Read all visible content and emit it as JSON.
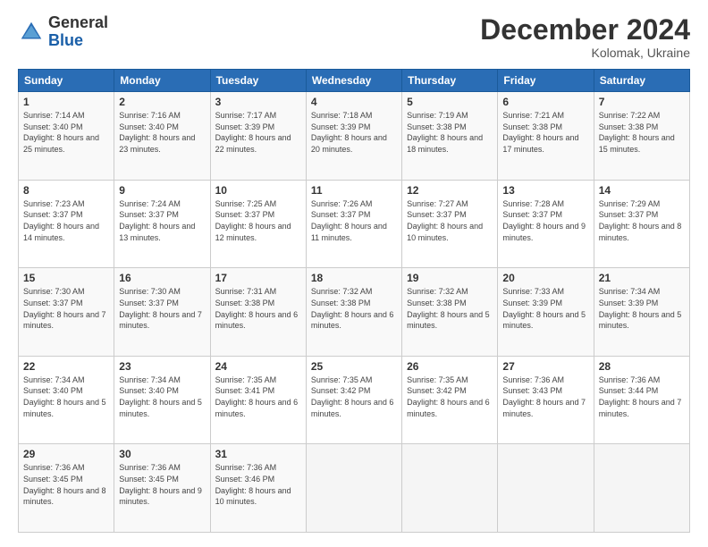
{
  "logo": {
    "general": "General",
    "blue": "Blue"
  },
  "header": {
    "month": "December 2024",
    "location": "Kolomak, Ukraine"
  },
  "weekdays": [
    "Sunday",
    "Monday",
    "Tuesday",
    "Wednesday",
    "Thursday",
    "Friday",
    "Saturday"
  ],
  "weeks": [
    [
      {
        "day": "1",
        "sunrise": "7:14 AM",
        "sunset": "3:40 PM",
        "daylight": "8 hours and 25 minutes."
      },
      {
        "day": "2",
        "sunrise": "7:16 AM",
        "sunset": "3:40 PM",
        "daylight": "8 hours and 23 minutes."
      },
      {
        "day": "3",
        "sunrise": "7:17 AM",
        "sunset": "3:39 PM",
        "daylight": "8 hours and 22 minutes."
      },
      {
        "day": "4",
        "sunrise": "7:18 AM",
        "sunset": "3:39 PM",
        "daylight": "8 hours and 20 minutes."
      },
      {
        "day": "5",
        "sunrise": "7:19 AM",
        "sunset": "3:38 PM",
        "daylight": "8 hours and 18 minutes."
      },
      {
        "day": "6",
        "sunrise": "7:21 AM",
        "sunset": "3:38 PM",
        "daylight": "8 hours and 17 minutes."
      },
      {
        "day": "7",
        "sunrise": "7:22 AM",
        "sunset": "3:38 PM",
        "daylight": "8 hours and 15 minutes."
      }
    ],
    [
      {
        "day": "8",
        "sunrise": "7:23 AM",
        "sunset": "3:37 PM",
        "daylight": "8 hours and 14 minutes."
      },
      {
        "day": "9",
        "sunrise": "7:24 AM",
        "sunset": "3:37 PM",
        "daylight": "8 hours and 13 minutes."
      },
      {
        "day": "10",
        "sunrise": "7:25 AM",
        "sunset": "3:37 PM",
        "daylight": "8 hours and 12 minutes."
      },
      {
        "day": "11",
        "sunrise": "7:26 AM",
        "sunset": "3:37 PM",
        "daylight": "8 hours and 11 minutes."
      },
      {
        "day": "12",
        "sunrise": "7:27 AM",
        "sunset": "3:37 PM",
        "daylight": "8 hours and 10 minutes."
      },
      {
        "day": "13",
        "sunrise": "7:28 AM",
        "sunset": "3:37 PM",
        "daylight": "8 hours and 9 minutes."
      },
      {
        "day": "14",
        "sunrise": "7:29 AM",
        "sunset": "3:37 PM",
        "daylight": "8 hours and 8 minutes."
      }
    ],
    [
      {
        "day": "15",
        "sunrise": "7:30 AM",
        "sunset": "3:37 PM",
        "daylight": "8 hours and 7 minutes."
      },
      {
        "day": "16",
        "sunrise": "7:30 AM",
        "sunset": "3:37 PM",
        "daylight": "8 hours and 7 minutes."
      },
      {
        "day": "17",
        "sunrise": "7:31 AM",
        "sunset": "3:38 PM",
        "daylight": "8 hours and 6 minutes."
      },
      {
        "day": "18",
        "sunrise": "7:32 AM",
        "sunset": "3:38 PM",
        "daylight": "8 hours and 6 minutes."
      },
      {
        "day": "19",
        "sunrise": "7:32 AM",
        "sunset": "3:38 PM",
        "daylight": "8 hours and 5 minutes."
      },
      {
        "day": "20",
        "sunrise": "7:33 AM",
        "sunset": "3:39 PM",
        "daylight": "8 hours and 5 minutes."
      },
      {
        "day": "21",
        "sunrise": "7:34 AM",
        "sunset": "3:39 PM",
        "daylight": "8 hours and 5 minutes."
      }
    ],
    [
      {
        "day": "22",
        "sunrise": "7:34 AM",
        "sunset": "3:40 PM",
        "daylight": "8 hours and 5 minutes."
      },
      {
        "day": "23",
        "sunrise": "7:34 AM",
        "sunset": "3:40 PM",
        "daylight": "8 hours and 5 minutes."
      },
      {
        "day": "24",
        "sunrise": "7:35 AM",
        "sunset": "3:41 PM",
        "daylight": "8 hours and 6 minutes."
      },
      {
        "day": "25",
        "sunrise": "7:35 AM",
        "sunset": "3:42 PM",
        "daylight": "8 hours and 6 minutes."
      },
      {
        "day": "26",
        "sunrise": "7:35 AM",
        "sunset": "3:42 PM",
        "daylight": "8 hours and 6 minutes."
      },
      {
        "day": "27",
        "sunrise": "7:36 AM",
        "sunset": "3:43 PM",
        "daylight": "8 hours and 7 minutes."
      },
      {
        "day": "28",
        "sunrise": "7:36 AM",
        "sunset": "3:44 PM",
        "daylight": "8 hours and 7 minutes."
      }
    ],
    [
      {
        "day": "29",
        "sunrise": "7:36 AM",
        "sunset": "3:45 PM",
        "daylight": "8 hours and 8 minutes."
      },
      {
        "day": "30",
        "sunrise": "7:36 AM",
        "sunset": "3:45 PM",
        "daylight": "8 hours and 9 minutes."
      },
      {
        "day": "31",
        "sunrise": "7:36 AM",
        "sunset": "3:46 PM",
        "daylight": "8 hours and 10 minutes."
      },
      null,
      null,
      null,
      null
    ]
  ],
  "labels": {
    "sunrise": "Sunrise:",
    "sunset": "Sunset:",
    "daylight": "Daylight:"
  }
}
